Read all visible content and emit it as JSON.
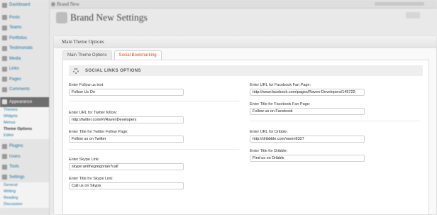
{
  "sidebar": {
    "items": [
      {
        "label": "Dashboard"
      },
      {
        "label": "Posts"
      },
      {
        "label": "Teams"
      },
      {
        "label": "Portfolios"
      },
      {
        "label": "Testimonials"
      },
      {
        "label": "Media"
      },
      {
        "label": "Links"
      },
      {
        "label": "Pages"
      },
      {
        "label": "Comments"
      },
      {
        "label": "Appearance"
      }
    ],
    "sub_items": [
      {
        "label": "Themes"
      },
      {
        "label": "Widgets"
      },
      {
        "label": "Menus"
      },
      {
        "label": "Theme Options"
      },
      {
        "label": "Editor"
      }
    ],
    "items_after": [
      {
        "label": "Plugins"
      },
      {
        "label": "Users"
      },
      {
        "label": "Tools"
      },
      {
        "label": "Settings"
      }
    ],
    "settings_sub": [
      {
        "label": "General"
      },
      {
        "label": "Writing"
      },
      {
        "label": "Reading"
      },
      {
        "label": "Discussion"
      }
    ]
  },
  "topbar": {
    "site_name": "Brand New"
  },
  "page": {
    "title": "Brand New Settings"
  },
  "panel": {
    "title": "Main Theme Options",
    "tabs": [
      {
        "label": "Main Theme Options"
      },
      {
        "label": "Social Bookmarking"
      }
    ],
    "section_title": "SOCIAL LINKS OPTIONS",
    "fields": {
      "follow_text": {
        "label": "Enter Follow us text",
        "value": "Follow Us On"
      },
      "twitter_url": {
        "label": "Enter URL for Twitter follow:",
        "value": "http://twitter.com/#!/RavenDevelopers"
      },
      "twitter_title": {
        "label": "Enter Title for Twitter Follow Page:",
        "value": "Follow us on Twitter"
      },
      "skype_link": {
        "label": "Enter Skype Link:",
        "value": "skype:anithegregorian?call"
      },
      "skype_title": {
        "label": "Enter Title for Skype Link:",
        "value": "Call us on Skype"
      },
      "facebook_url": {
        "label": "Enter URL for Facebook Fan Page:",
        "value": "http://www.facebook.com/pages/Raven-Developers/145722-"
      },
      "facebook_title": {
        "label": "Enter Title for Facebook Fan Page:",
        "value": "Follow us on Facebook"
      },
      "dribble_url": {
        "label": "Enter URL for Dribble:",
        "value": "http://dribbble.com/raven9327"
      },
      "dribble_title": {
        "label": "Enter Title for Dribble:",
        "value": "Find us on Dribble"
      }
    }
  },
  "colors": {
    "accent_tab": "#d54e21",
    "link": "#21759b",
    "active_menu": "#6d6d6d"
  }
}
